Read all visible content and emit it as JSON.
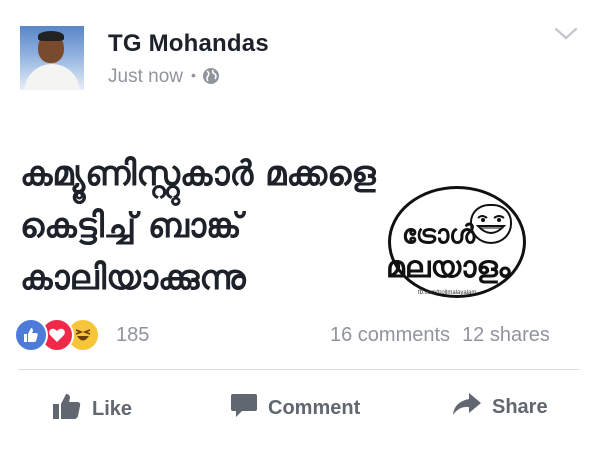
{
  "post": {
    "author": "TG Mohandas",
    "timestamp": "Just now",
    "separator": "•",
    "visibility_icon": "globe-icon",
    "text_lines": [
      "കമ്യൂണിസ്റ്റുകാർ മക്കളെ",
      "കെട്ടിച്ച് ബാങ്ക്",
      "കാലിയാക്കുന്നു"
    ],
    "watermark": {
      "line1": "ട്രോൾ",
      "line2": "മലയാളം",
      "caption": "fb.com/trollmalayalam"
    }
  },
  "stats": {
    "reaction_icons": [
      "like-reaction-icon",
      "love-reaction-icon",
      "haha-reaction-icon"
    ],
    "reaction_count": "185",
    "comments": "16 comments",
    "shares": "12 shares"
  },
  "actions": {
    "like": "Like",
    "comment": "Comment",
    "share": "Share"
  },
  "colors": {
    "like_blue": "#4c7bd9",
    "love_red": "#f0284a",
    "haha_yellow": "#f7c53a",
    "meta_gray": "#90949c",
    "action_gray": "#606770"
  }
}
